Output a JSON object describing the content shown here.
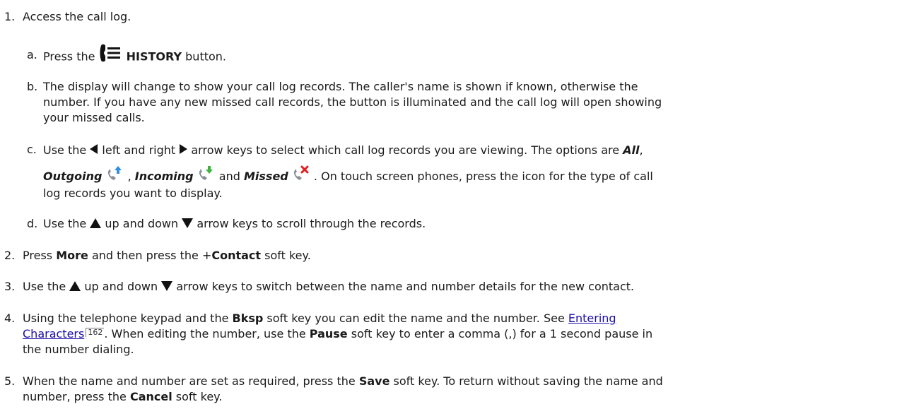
{
  "steps": [
    {
      "num": "1.",
      "text": "Access the call log."
    },
    {
      "num": "2.",
      "pre": "Press ",
      "more": "More",
      "mid": " and then press the +",
      "contact": "Contact",
      "post": " soft key."
    },
    {
      "num": "3.",
      "pre": "Use the ",
      "mid": " up and down ",
      "post": " arrow keys to switch between the name and number details for the new contact."
    },
    {
      "num": "4.",
      "pre": "Using the telephone keypad and the ",
      "bksp": "Bksp",
      "mid": " soft key you can edit the name and the number. See ",
      "link1": "Entering",
      "link2": "Characters",
      "ref": "162",
      "mid2": ". When editing the number, use the ",
      "pause": "Pause",
      "post1": " soft key to enter a comma (,) for a 1 second pause in",
      "post2": "the number dialing."
    },
    {
      "num": "5.",
      "pre": "When the name and number are set as required, press the ",
      "save": "Save",
      "mid": " soft key. To return without saving the name and",
      "line2pre": "number, press the ",
      "cancel": "Cancel",
      "post": " soft key."
    }
  ],
  "substeps": [
    {
      "num": "a.",
      "pre": "Press the ",
      "history": "HISTORY",
      "post": " button."
    },
    {
      "num": "b.",
      "line1": "The display will change to show your call log records. The caller's name is shown if known, otherwise the",
      "line2": "number. If you have any new missed call records, the button is illuminated and the call log will open showing",
      "line3": "your missed calls."
    },
    {
      "num": "c.",
      "pre": "Use the ",
      "mid": " left and right ",
      "post": " arrow keys to select which call log records you are viewing. The options are ",
      "all": "All",
      "comma": ",",
      "outgoing": "Outgoing",
      "sep": " , ",
      "incoming": "Incoming",
      "and": " and ",
      "missed": "Missed",
      "post2": " . On touch screen phones, press the icon for the type of call",
      "line3": "log records you want to display."
    },
    {
      "num": "d.",
      "pre": "Use the ",
      "mid": " up and down ",
      "post": " arrow keys to scroll through the records."
    }
  ],
  "icons": {
    "history": "history-icon",
    "left": "left-arrow-icon",
    "right": "right-arrow-icon",
    "up": "up-arrow-icon",
    "down": "down-arrow-icon",
    "outgoing": "outgoing-call-icon",
    "incoming": "incoming-call-icon",
    "missed": "missed-call-icon"
  },
  "colors": {
    "call_icon": "#8a8f96",
    "outgoing_arrow": "#2f8fe0",
    "incoming_arrow": "#3db33d",
    "missed_x": "#e02020",
    "link": "#1a0dab"
  }
}
